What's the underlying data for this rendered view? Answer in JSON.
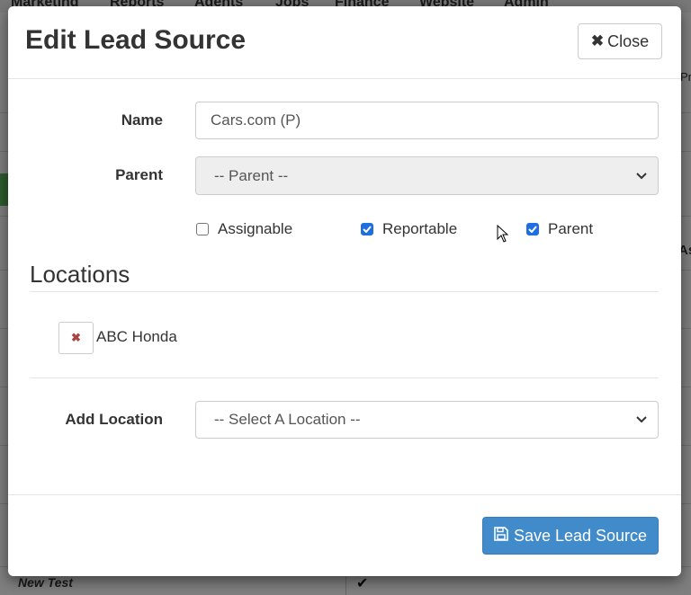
{
  "background": {
    "nav": [
      "Marketing",
      "Reports",
      "Agents",
      "Jobs",
      "Finance",
      "Website",
      "Admin"
    ],
    "right_fragments": [
      "Pr",
      "As"
    ],
    "last_row_name": "New Test"
  },
  "modal": {
    "title": "Edit Lead Source",
    "close_label": "Close",
    "name_label": "Name",
    "name_value": "Cars.com (P)",
    "parent_label": "Parent",
    "parent_selected": "-- Parent --",
    "checkboxes": [
      {
        "label": "Assignable",
        "checked": false
      },
      {
        "label": "Reportable",
        "checked": true
      },
      {
        "label": "Parent",
        "checked": true
      }
    ],
    "locations_title": "Locations",
    "locations": [
      {
        "name": "ABC Honda"
      }
    ],
    "add_location_label": "Add Location",
    "add_location_selected": "-- Select A Location --",
    "save_label": "Save Lead Source"
  },
  "colors": {
    "primary": "#428bca",
    "checkbox": "#1f6fe0",
    "remove": "#a94442"
  }
}
